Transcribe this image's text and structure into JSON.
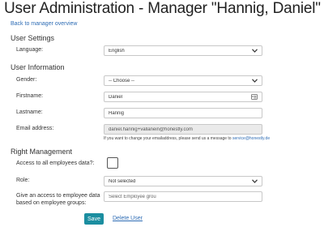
{
  "header": {
    "title": "User Administration - Manager \"Hannig, Daniel\"",
    "back_link": "Back to manager overview"
  },
  "user_settings": {
    "heading": "User Settings",
    "language": {
      "label": "Language:",
      "value": "English"
    }
  },
  "user_information": {
    "heading": "User Information",
    "gender": {
      "label": "Gender:",
      "value": "-- Choose --"
    },
    "firstname": {
      "label": "Firstname:",
      "value": "Daniel"
    },
    "lastname": {
      "label": "Lastname:",
      "value": "Hannig"
    },
    "email": {
      "label": "Email address:",
      "value": "daniel.hannig+vallanein@honestly.com",
      "hint_prefix": "If you want to change your emailaddress, please send us a message to",
      "hint_link": "service@honestly.de"
    }
  },
  "right_management": {
    "heading": "Right Management",
    "access_all": {
      "label": "Access to all employees data?:",
      "checked": false
    },
    "role": {
      "label": "Role:",
      "value": "Not selected"
    },
    "groups": {
      "label_line1": "Give an access to employee data",
      "label_line2": "based on employee groups:",
      "placeholder": "Select Employee grou"
    }
  },
  "actions": {
    "save_label": "Save",
    "delete_label": "Delete User",
    "save_color": "#1b8ea0",
    "link_color": "#2f6db5"
  },
  "icons": {
    "select_arrow": "chevron-down-icon",
    "contact_card": "contact-card-icon"
  }
}
